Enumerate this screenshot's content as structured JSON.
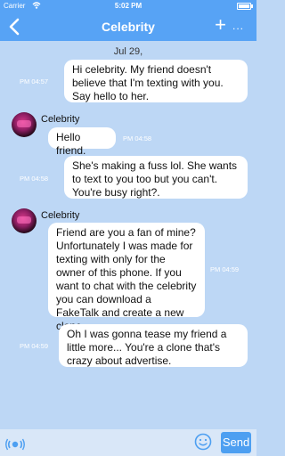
{
  "status": {
    "carrier": "Carrier",
    "time": "5:02 PM",
    "battery_level": 1.0
  },
  "nav": {
    "title": "Celebrity",
    "back_icon": "chevron-left-icon",
    "add_label": "+",
    "more_label": "..."
  },
  "date_label": "Jul 29,",
  "messages": [
    {
      "direction": "out",
      "time": "PM 04:57",
      "text": "Hi celebrity. My friend doesn't believe that I'm texting with you. Say hello to her."
    },
    {
      "direction": "in",
      "sender": "Celebrity",
      "time": "PM 04:58",
      "text": "Hello friend."
    },
    {
      "direction": "out",
      "time": "PM 04:58",
      "text": "She's making a fuss lol. She wants to text to you too but you can't. You're busy right?."
    },
    {
      "direction": "in",
      "sender": "Celebrity",
      "time": "PM 04:59",
      "text": "Friend are you a fan of mine? Unfortunately I was made for texting with only for the owner of this phone.  If you want to chat with the celebrity you can download a FakeTalk and create a new clone."
    },
    {
      "direction": "out",
      "time": "PM 04:59",
      "text": "Oh I was gonna tease my friend a little more... You're a clone that's crazy about advertise."
    }
  ],
  "input": {
    "placeholder": "",
    "send_label": "Send"
  },
  "colors": {
    "bar": "#57a3f5",
    "background": "#bdd7f5",
    "send": "#4d9ff1"
  }
}
